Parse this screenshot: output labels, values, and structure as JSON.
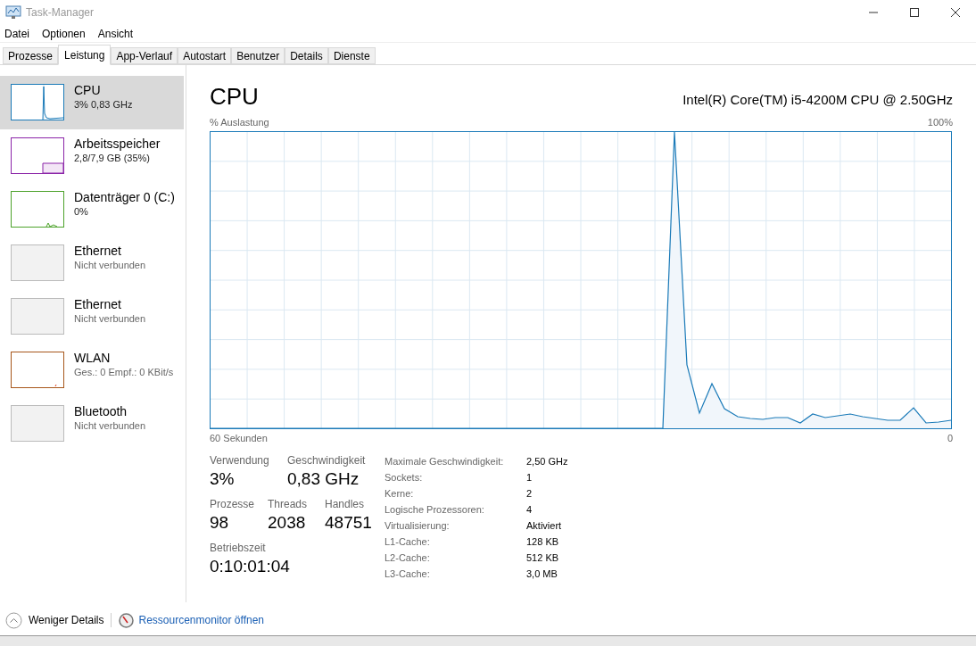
{
  "window": {
    "title": "Task-Manager"
  },
  "menu": [
    "Datei",
    "Optionen",
    "Ansicht"
  ],
  "tabs": [
    {
      "label": "Prozesse",
      "selected": false
    },
    {
      "label": "Leistung",
      "selected": true
    },
    {
      "label": "App-Verlauf",
      "selected": false
    },
    {
      "label": "Autostart",
      "selected": false
    },
    {
      "label": "Benutzer",
      "selected": false
    },
    {
      "label": "Details",
      "selected": false
    },
    {
      "label": "Dienste",
      "selected": false
    }
  ],
  "sidebar": {
    "items": [
      {
        "kind": "cpu",
        "name": "CPU",
        "detail": "3% 0,83 GHz",
        "color": "#1a7ab8",
        "selected": true
      },
      {
        "kind": "memory",
        "name": "Arbeitsspeicher",
        "detail": "2,8/7,9 GB (35%)",
        "color": "#8b24a8",
        "selected": false
      },
      {
        "kind": "disk",
        "name": "Datenträger 0 (C:)",
        "detail": "0%",
        "color": "#4ca22a",
        "selected": false
      },
      {
        "kind": "off",
        "name": "Ethernet",
        "detail": "Nicht verbunden",
        "selected": false
      },
      {
        "kind": "off",
        "name": "Ethernet",
        "detail": "Nicht verbunden",
        "selected": false
      },
      {
        "kind": "wlan",
        "name": "WLAN",
        "detail": "Ges.: 0 Empf.: 0 KBit/s",
        "color": "#a7561a",
        "selected": false
      },
      {
        "kind": "off",
        "name": "Bluetooth",
        "detail": "Nicht verbunden",
        "selected": false
      }
    ]
  },
  "main": {
    "title": "CPU",
    "processor": "Intel(R) Core(TM) i5-4200M CPU @ 2.50GHz",
    "graph_label": "% Auslastung",
    "graph_max": "100%",
    "graph_span": "60 Sekunden",
    "graph_min": "0",
    "stats": [
      {
        "label": "Verwendung",
        "value": "3%"
      },
      {
        "label": "Geschwindigkeit",
        "value": "0,83 GHz"
      }
    ],
    "stats2": [
      {
        "label": "Prozesse",
        "value": "98"
      },
      {
        "label": "Threads",
        "value": "2038"
      },
      {
        "label": "Handles",
        "value": "48751"
      }
    ],
    "uptime": {
      "label": "Betriebszeit",
      "value": "0:10:01:04"
    },
    "details": [
      {
        "label": "Maximale Geschwindigkeit:",
        "value": "2,50 GHz"
      },
      {
        "label": "Sockets:",
        "value": "1"
      },
      {
        "label": "Kerne:",
        "value": "2"
      },
      {
        "label": "Logische Prozessoren:",
        "value": "4"
      },
      {
        "label": "Virtualisierung:",
        "value": "Aktiviert"
      },
      {
        "label": "L1-Cache:",
        "value": "128 KB"
      },
      {
        "label": "L2-Cache:",
        "value": "512 KB"
      },
      {
        "label": "L3-Cache:",
        "value": "3,0 MB"
      }
    ]
  },
  "footer": {
    "less_details": "Weniger Details",
    "resource_monitor": "Ressourcenmonitor öffnen"
  }
}
